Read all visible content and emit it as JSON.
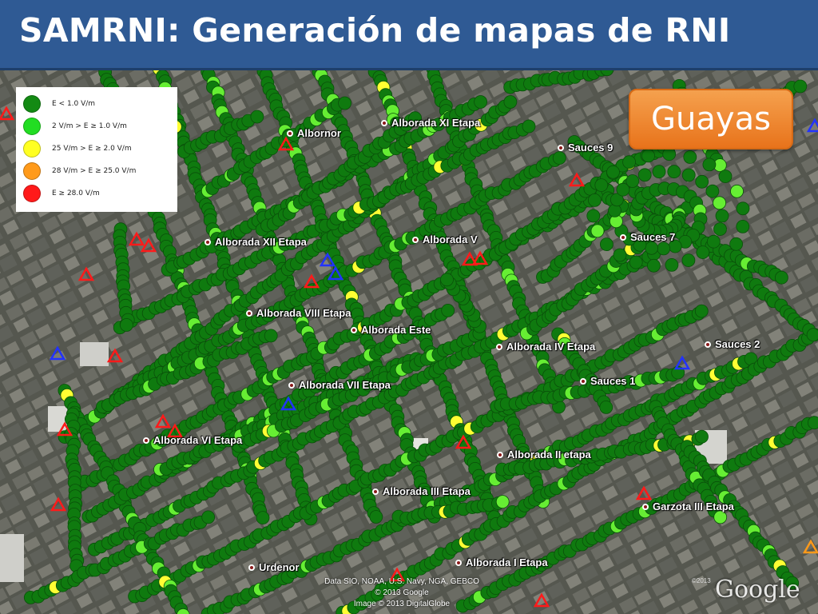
{
  "title": "SAMRNI: Generación de mapas de RNI",
  "region_label": "Guayas",
  "legend": [
    {
      "label": "E < 1.0 V/m",
      "color": "#138a13"
    },
    {
      "label": "2 V/m > E ≥ 1.0 V/m",
      "color": "#22dd22"
    },
    {
      "label": "25 V/m > E ≥ 2.0 V/m",
      "color": "#ffff22"
    },
    {
      "label": "28 V/m > E ≥ 25.0 V/m",
      "color": "#ff9a1a"
    },
    {
      "label": "E ≥ 28.0 V/m",
      "color": "#ff1a1a"
    }
  ],
  "places": [
    {
      "name": "Albornor"
    },
    {
      "name": "Alborada XI Etapa"
    },
    {
      "name": "Sauces 9"
    },
    {
      "name": "Alborada XII Etapa"
    },
    {
      "name": "Alborada V"
    },
    {
      "name": "Sauces 7"
    },
    {
      "name": "Alborada VIII Etapa"
    },
    {
      "name": "Alborada Este"
    },
    {
      "name": "Alborada IV Etapa"
    },
    {
      "name": "Sauces 2"
    },
    {
      "name": "Alborada VII Etapa"
    },
    {
      "name": "Sauces 1"
    },
    {
      "name": "Alborada VI Etapa"
    },
    {
      "name": "Alborada II etapa"
    },
    {
      "name": "Alborada III Etapa"
    },
    {
      "name": "Garzota III Etapa"
    },
    {
      "name": "Urdenor"
    },
    {
      "name": "Alborada I Etapa"
    }
  ],
  "attribution": {
    "line1": "Data SIO, NOAA, U.S. Navy, NGA, GEBCO",
    "line2": "© 2013 Google",
    "line3": "Image © 2013 DigitalGlobe"
  },
  "logo": {
    "text": "Google",
    "year": "©2013"
  },
  "icons": {
    "red_marker": "red-triangle-icon",
    "blue_marker": "blue-triangle-icon",
    "place_marker": "place-pin-icon"
  }
}
